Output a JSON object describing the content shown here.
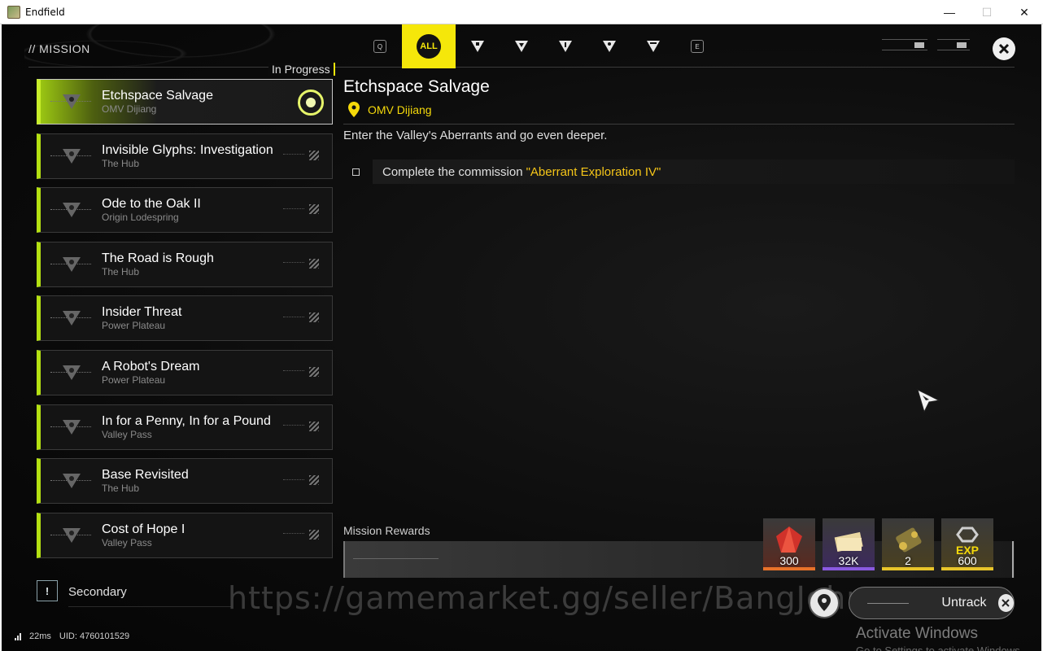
{
  "window": {
    "title": "Endfield",
    "controls": {
      "minimize": "—",
      "maximize": "☐",
      "close": "✕"
    }
  },
  "header": {
    "title": "// MISSION",
    "section_label": "In Progress"
  },
  "tabs": [
    {
      "kind": "key",
      "label": "Q"
    },
    {
      "kind": "all",
      "label": "ALL",
      "active": true
    },
    {
      "kind": "icon",
      "icon": "mission-type-1-icon"
    },
    {
      "kind": "icon",
      "icon": "mission-type-2-icon"
    },
    {
      "kind": "icon",
      "icon": "mission-type-3-icon"
    },
    {
      "kind": "icon",
      "icon": "mission-type-4-icon"
    },
    {
      "kind": "icon",
      "icon": "mission-type-5-icon"
    },
    {
      "kind": "key",
      "label": "E"
    }
  ],
  "missions": [
    {
      "title": "Etchspace Salvage",
      "location": "OMV Dijiang",
      "selected": true,
      "tracked": true
    },
    {
      "title": "Invisible Glyphs: Investigation",
      "location": "The Hub"
    },
    {
      "title": "Ode to the Oak II",
      "location": "Origin Lodespring"
    },
    {
      "title": "The Road is Rough",
      "location": "The Hub"
    },
    {
      "title": "Insider Threat",
      "location": "Power Plateau"
    },
    {
      "title": "A Robot's Dream",
      "location": "Power Plateau"
    },
    {
      "title": "In for a Penny, In for a Pound",
      "location": "Valley Pass"
    },
    {
      "title": "Base Revisited",
      "location": "The Hub"
    },
    {
      "title": "Cost of Hope I",
      "location": "Valley Pass"
    }
  ],
  "detail": {
    "title": "Etchspace Salvage",
    "location": "OMV Dijiang",
    "description": "Enter the Valley's Aberrants and go even deeper.",
    "objective_text": "Complete the commission",
    "objective_target": "\"Aberrant Exploration IV\""
  },
  "rewards": {
    "label": "Mission Rewards",
    "items": [
      {
        "icon": "red-crystal-icon",
        "quantity": "300",
        "rarity_color": "#e8722a"
      },
      {
        "icon": "credit-bundle-icon",
        "quantity": "32K",
        "rarity_color": "#8a5ae0"
      },
      {
        "icon": "device-part-icon",
        "quantity": "2",
        "rarity_color": "#e8c52a"
      },
      {
        "icon": "exp-icon",
        "quantity": "600",
        "rarity_color": "#e8c52a"
      }
    ]
  },
  "secondary": {
    "badge": "!",
    "label": "Secondary"
  },
  "actions": {
    "untrack_label": "Untrack"
  },
  "watermark": "https://gamemarket.gg/seller/BangJohn",
  "os_notice": {
    "title": "Activate Windows",
    "subtitle": "Go to Settings to activate Windows."
  },
  "status": {
    "ping": "22ms",
    "uid": "UID: 4760101529"
  },
  "colors": {
    "accent_yellow": "#f5e70a",
    "accent_lime": "#b4e012",
    "quote_gold": "#f5c518"
  }
}
